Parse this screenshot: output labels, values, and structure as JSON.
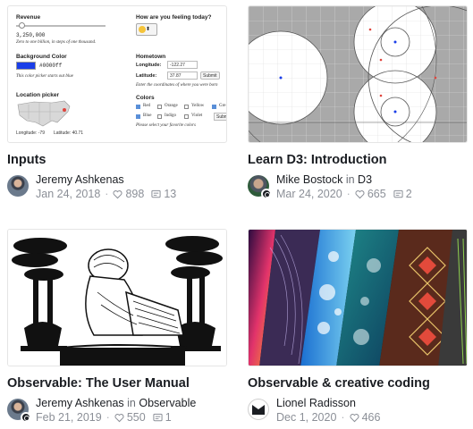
{
  "cards": [
    {
      "title": "Inputs",
      "author": "Jeremy Ashkenas",
      "collection": "",
      "date": "Jan 24, 2018",
      "likes": "898",
      "comments": "13",
      "preview": {
        "revenue_label": "Revenue",
        "revenue_value": "3,250,000",
        "revenue_hint": "Zero to one billion, in steps of one thousand.",
        "bg_label": "Background Color",
        "bg_value": "#0000ff",
        "bg_hint": "This color picker starts out blue",
        "location_label": "Location picker",
        "lon_text": "Longitude: -79",
        "lat_text": "Latitude: 40.71",
        "feeling_label": "How are you feeling today?",
        "hometown_label": "Hometown",
        "longitude_label": "Longitude:",
        "longitude_value": "-122.27",
        "latitude_label": "Latitude:",
        "latitude_value": "37.87",
        "submit": "Submit",
        "coord_hint": "Enter the coordinates of where you were born",
        "colors_label": "Colors",
        "color_options": [
          "Red",
          "Orange",
          "Yellow",
          "Gre",
          "Blue",
          "Indigo",
          "Violet",
          "Subm"
        ],
        "colors_hint": "Please select your favorite colors"
      }
    },
    {
      "title": "Learn D3: Introduction",
      "author": "Mike Bostock",
      "collection": "D3",
      "date": "Mar 24, 2020",
      "likes": "665",
      "comments": "2"
    },
    {
      "title": "Observable: The User Manual",
      "author": "Jeremy Ashkenas",
      "collection": "Observable",
      "date": "Feb 21, 2019",
      "likes": "550",
      "comments": "1"
    },
    {
      "title": "Observable & creative coding",
      "author": "Lionel Radisson",
      "collection": "",
      "date": "Dec 1, 2020",
      "likes": "466",
      "comments": ""
    }
  ],
  "labels": {
    "in": "in"
  },
  "colors": {
    "title": "#1b1e23",
    "meta": "#8b8f97",
    "accent_red": "#e0443c",
    "accent_blue": "#1a3ee8"
  }
}
